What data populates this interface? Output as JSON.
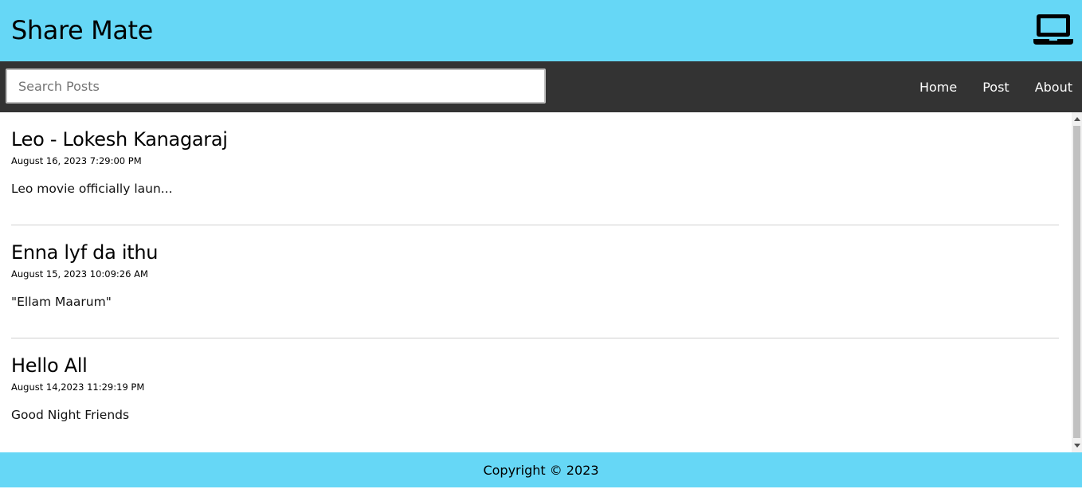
{
  "header": {
    "title": "Share Mate",
    "icon": "laptop-icon"
  },
  "nav": {
    "search_placeholder": "Search Posts",
    "search_value": "",
    "links": [
      "Home",
      "Post",
      "About"
    ]
  },
  "posts": [
    {
      "title": "Leo - Lokesh Kanagaraj",
      "date": "August 16, 2023 7:29:00 PM",
      "body": "Leo movie officially laun..."
    },
    {
      "title": "Enna lyf da ithu",
      "date": "August 15, 2023 10:09:26 AM",
      "body": "\"Ellam Maarum\""
    },
    {
      "title": "Hello All",
      "date": "August 14,2023 11:29:19 PM",
      "body": "Good Night Friends"
    }
  ],
  "footer": {
    "copyright": "Copyright © 2023"
  },
  "colors": {
    "header_bg": "#66d7f6",
    "nav_bg": "#333333"
  }
}
